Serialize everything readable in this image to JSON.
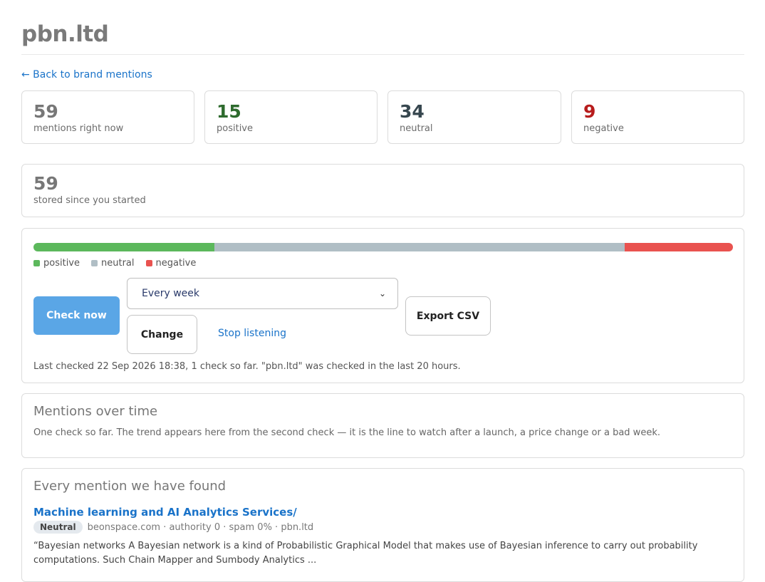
{
  "header": {
    "title": "pbn.ltd",
    "back_link": "← Back to brand mentions"
  },
  "stats": {
    "mentions": {
      "value": "59",
      "label": "mentions right now",
      "color": "#777777"
    },
    "positive": {
      "value": "15",
      "label": "positive",
      "color": "#2e6b2e"
    },
    "neutral": {
      "value": "34",
      "label": "neutral",
      "color": "#37474f"
    },
    "negative": {
      "value": "9",
      "label": "negative",
      "color": "#b71c1c"
    }
  },
  "stored": {
    "value": "59",
    "label": "stored since you started"
  },
  "sentiment": {
    "positive_count": 15,
    "neutral_count": 34,
    "negative_count": 9,
    "colors": {
      "positive": "#5cb85c",
      "neutral": "#b0bec5",
      "negative": "#e9524f"
    },
    "legend": {
      "positive": "positive",
      "neutral": "neutral",
      "negative": "negative"
    }
  },
  "controls": {
    "check_now": "Check now",
    "frequency_value": "Every week",
    "change": "Change",
    "stop_listening": "Stop listening",
    "export_csv": "Export CSV",
    "last_checked": "Last checked 22 Sep 2026 18:38, 1 check so far. \"pbn.ltd\" was checked in the last 20 hours."
  },
  "over_time": {
    "title": "Mentions over time",
    "description": "One check so far. The trend appears here from the second check — it is the line to watch after a launch, a price change or a bad week."
  },
  "mentions_list": {
    "title": "Every mention we have found",
    "items": [
      {
        "title": "Machine learning and AI Analytics Services/",
        "badge": "Neutral",
        "meta": "beonspace.com · authority 0 · spam 0% · pbn.ltd",
        "snippet": "“Bayesian networks A Bayesian network is a kind of Probabilistic Graphical Model that makes use of Bayesian inference to carry out probability computations. Such Chain Mapper and Sumbody Analytics ..."
      }
    ]
  }
}
